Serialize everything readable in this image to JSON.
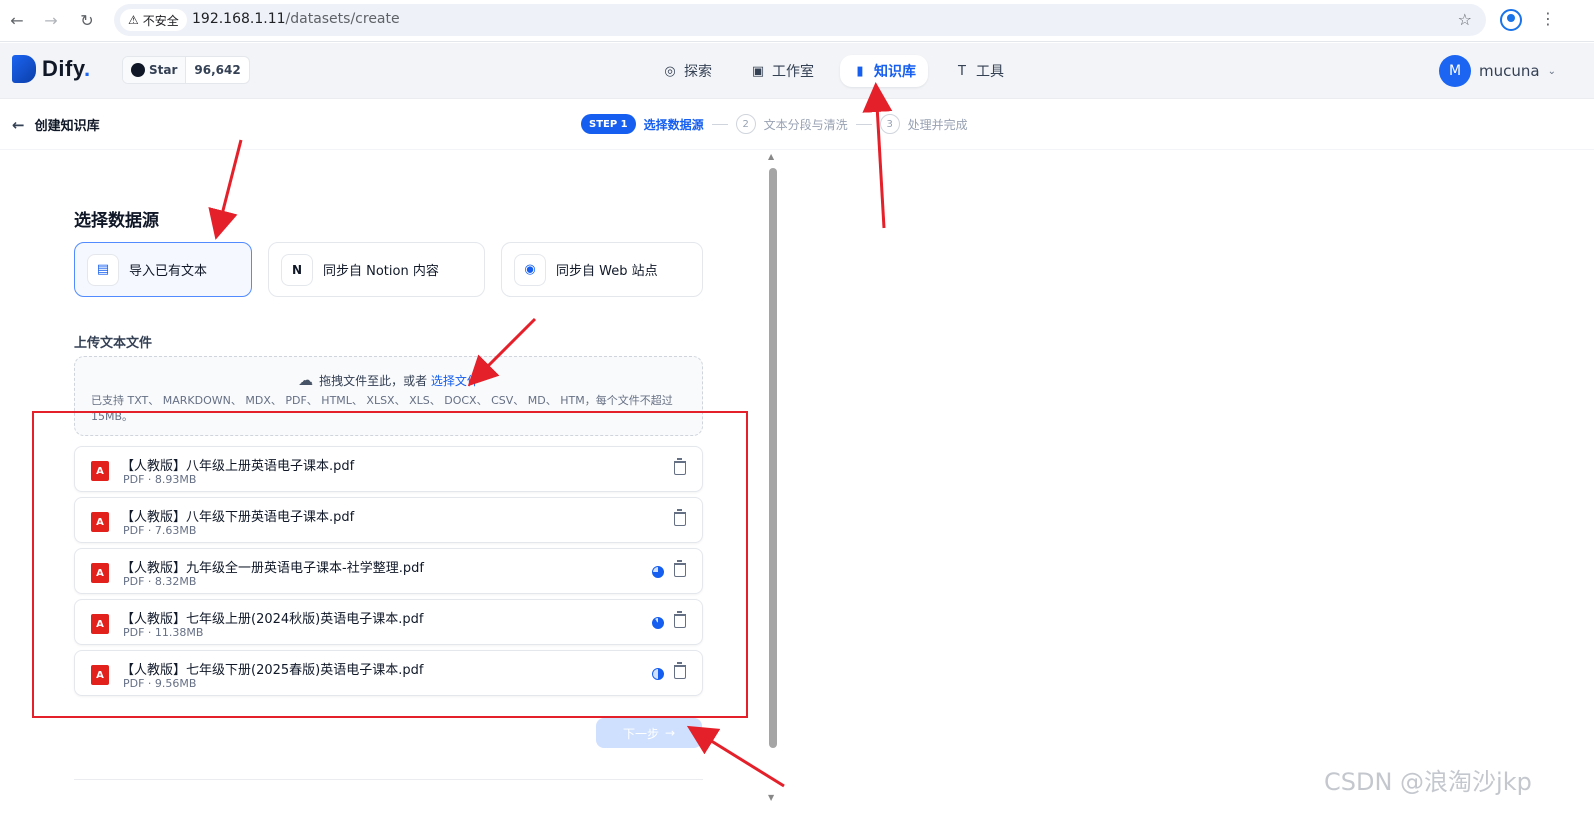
{
  "browser": {
    "security_label": "不安全",
    "url_host": "192.168.1.11",
    "url_path": "/datasets/create"
  },
  "header": {
    "logo_text": "Dify",
    "logo_dot": ".",
    "github": {
      "label": "Star",
      "count": "96,642"
    },
    "nav": [
      {
        "label": "探索",
        "icon": "compass-icon",
        "active": false
      },
      {
        "label": "工作室",
        "icon": "robot-icon",
        "active": false
      },
      {
        "label": "知识库",
        "icon": "book-icon",
        "active": true
      },
      {
        "label": "工具",
        "icon": "hammer-icon",
        "active": false
      }
    ],
    "user": {
      "initial": "M",
      "name": "mucuna"
    }
  },
  "subheader": {
    "back_label": "创建知识库",
    "steps": [
      {
        "badge": "STEP 1",
        "label": "选择数据源",
        "active": true
      },
      {
        "num": "2",
        "label": "文本分段与清洗",
        "active": false
      },
      {
        "num": "3",
        "label": "处理并完成",
        "active": false
      }
    ]
  },
  "main": {
    "section_title": "选择数据源",
    "sources": [
      {
        "label": "导入已有文本",
        "icon": "file-text-icon",
        "selected": true
      },
      {
        "label": "同步自 Notion 内容",
        "icon": "notion-icon",
        "selected": false
      },
      {
        "label": "同步自 Web 站点",
        "icon": "globe-icon",
        "selected": false
      }
    ],
    "upload_label": "上传文本文件",
    "drop_text": "拖拽文件至此，或者",
    "drop_link": "选择文件",
    "drop_tip": "已支持 TXT、 MARKDOWN、 MDX、 PDF、 HTML、 XLSX、 XLS、 DOCX、 CSV、 MD、 HTM，每个文件不超过 15MB。",
    "files": [
      {
        "name": "【人教版】八年级上册英语电子课本.pdf",
        "meta": "PDF · 8.93MB",
        "progress": null
      },
      {
        "name": "【人教版】八年级下册英语电子课本.pdf",
        "meta": "PDF · 7.63MB",
        "progress": null
      },
      {
        "name": "【人教版】九年级全一册英语电子课本-社学整理.pdf",
        "meta": "PDF · 8.32MB",
        "progress": 0.75
      },
      {
        "name": "【人教版】七年级上册(2024秋版)英语电子课本.pdf",
        "meta": "PDF · 11.38MB",
        "progress": 0.9
      },
      {
        "name": "【人教版】七年级下册(2025春版)英语电子课本.pdf",
        "meta": "PDF · 9.56MB",
        "progress": 0.5
      }
    ],
    "next_label": "下一步",
    "next_arrow": "→"
  },
  "watermark": "CSDN @浪淘沙jkp",
  "colors": {
    "accent": "#155eef",
    "annotation": "#e4202a"
  }
}
